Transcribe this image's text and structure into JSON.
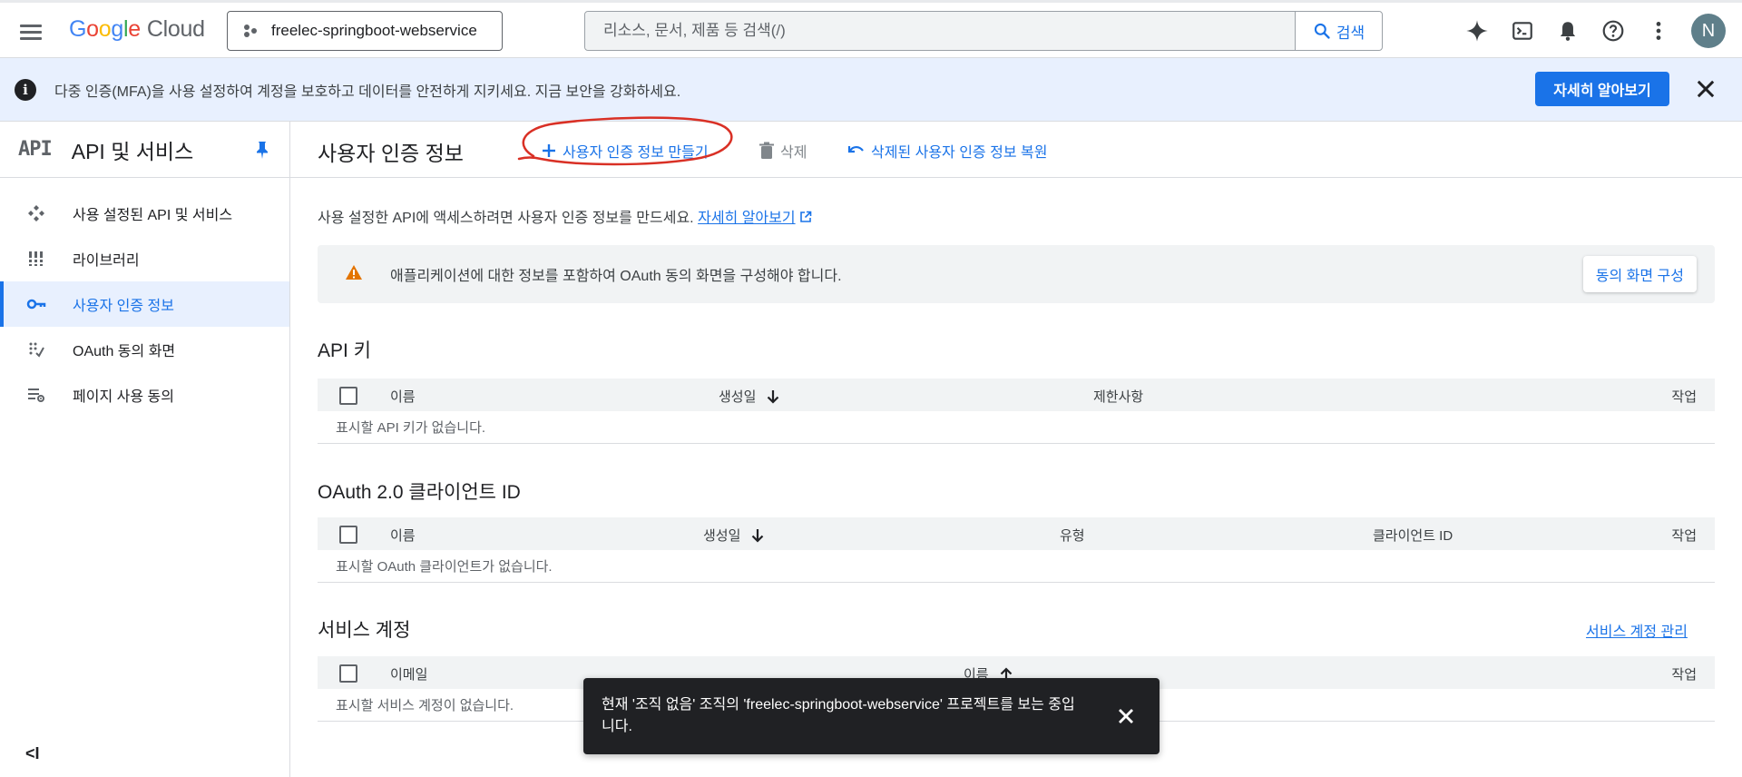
{
  "topbar": {
    "logo_google": [
      "G",
      "o",
      "o",
      "g",
      "l",
      "e"
    ],
    "logo_cloud": "Cloud",
    "project": "freelec-springboot-webservice",
    "search_placeholder": "리소스, 문서, 제품 등 검색(/)",
    "search_button": "검색",
    "avatar_letter": "N"
  },
  "banner": {
    "text": "다중 인증(MFA)을 사용 설정하여 계정을 보호하고 데이터를 안전하게 지키세요. 지금 보안을 강화하세요.",
    "button": "자세히 알아보기",
    "info_glyph": "i"
  },
  "sidebar": {
    "logo_text": "API",
    "title": "API 및 서비스",
    "items": [
      {
        "label": "사용 설정된 API 및 서비스",
        "icon": "enabled-apis-icon"
      },
      {
        "label": "라이브러리",
        "icon": "library-icon"
      },
      {
        "label": "사용자 인증 정보",
        "icon": "key-icon",
        "active": true
      },
      {
        "label": "OAuth 동의 화면",
        "icon": "oauth-consent-icon"
      },
      {
        "label": "페이지 사용 동의",
        "icon": "page-usage-icon"
      }
    ],
    "collapse_glyph": "<I"
  },
  "main": {
    "title": "사용자 인증 정보",
    "actions": {
      "create": "사용자 인증 정보 만들기",
      "delete": "삭제",
      "restore": "삭제된 사용자 인증 정보 복원"
    },
    "intro": "사용 설정한 API에 액세스하려면 사용자 인증 정보를 만드세요.",
    "intro_link": "자세히 알아보기",
    "warning": {
      "text": "애플리케이션에 대한 정보를 포함하여 OAuth 동의 화면을 구성해야 합니다.",
      "button": "동의 화면 구성"
    },
    "sections": {
      "api_keys": {
        "title": "API 키",
        "columns": [
          "이름",
          "생성일",
          "제한사항",
          "작업"
        ],
        "empty": "표시할 API 키가 없습니다."
      },
      "oauth": {
        "title": "OAuth 2.0 클라이언트 ID",
        "columns": [
          "이름",
          "생성일",
          "유형",
          "클라이언트 ID",
          "작업"
        ],
        "empty": "표시할 OAuth 클라이언트가 없습니다."
      },
      "service_accounts": {
        "title": "서비스 계정",
        "manage_link": "서비스 계정 관리",
        "columns": [
          "이메일",
          "이름",
          "작업"
        ],
        "empty": "표시할 서비스 계정이 없습니다."
      }
    }
  },
  "snackbar": {
    "message": "현재 '조직 없음' 조직의 'freelec-springboot-webservice' 프로젝트를 보는 중입니다."
  },
  "colors": {
    "accent": "#1a73e8",
    "banner_bg": "#e8f0fe",
    "warning": "#e37400",
    "annotation": "#d93025"
  }
}
